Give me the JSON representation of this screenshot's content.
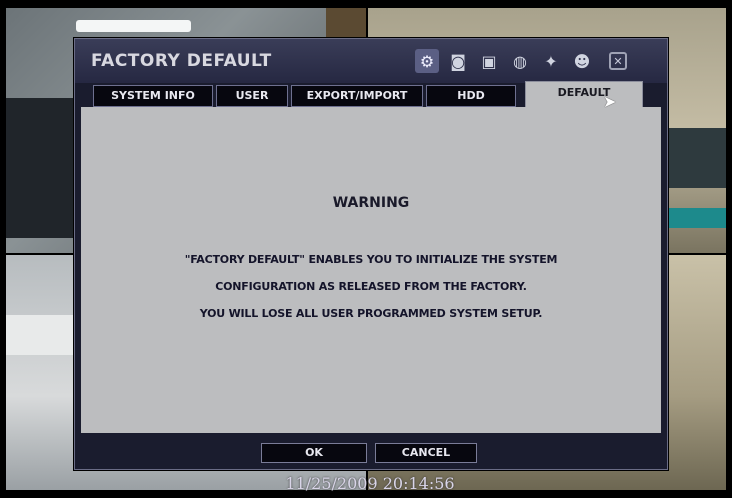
{
  "dialog": {
    "title": "FACTORY DEFAULT",
    "toolbar_icons": [
      "gear-icon",
      "camera-icon",
      "record-icon",
      "network-icon",
      "event-icon",
      "user-icon"
    ]
  },
  "tabs": [
    {
      "label": "SYSTEM INFO"
    },
    {
      "label": "USER"
    },
    {
      "label": "EXPORT/IMPORT"
    },
    {
      "label": "HDD"
    },
    {
      "label": "DEFAULT"
    }
  ],
  "content": {
    "warning_title": "WARNING",
    "line1": "\"FACTORY DEFAULT\" ENABLES YOU TO INITIALIZE THE SYSTEM",
    "line2": "CONFIGURATION AS RELEASED FROM THE FACTORY.",
    "line3": "YOU WILL LOSE ALL USER PROGRAMMED SYSTEM SETUP."
  },
  "buttons": {
    "ok": "OK",
    "cancel": "CANCEL"
  },
  "overlay": {
    "timestamp": "11/25/2009 20:14:56"
  },
  "colors": {
    "accent": "#5b5f84",
    "content_bg": "#bcbdbf",
    "dialog_bg": "#1a1c2e"
  }
}
